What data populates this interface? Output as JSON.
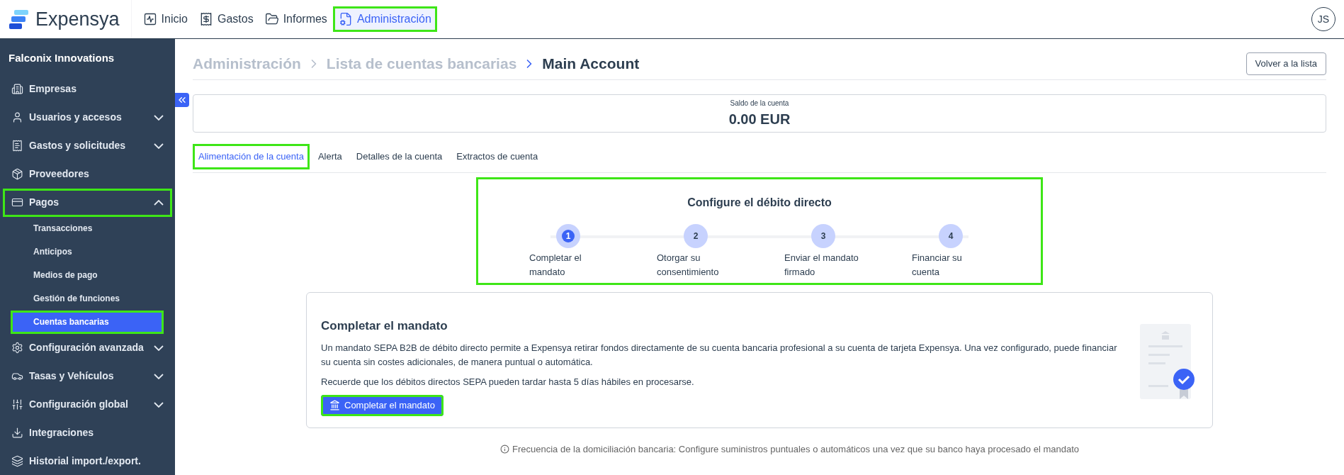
{
  "header": {
    "logo": "Expensya",
    "nav": [
      {
        "label": "Inicio",
        "selected": false,
        "highlighted": false
      },
      {
        "label": "Gastos",
        "selected": false,
        "highlighted": false
      },
      {
        "label": "Informes",
        "selected": false,
        "highlighted": false
      },
      {
        "label": "Administración",
        "selected": true,
        "highlighted": true
      }
    ],
    "avatar": "JS"
  },
  "sidebar": {
    "company": "Falconix Innovations",
    "items": [
      {
        "label": "Empresas"
      },
      {
        "label": "Usuarios y accesos",
        "expanded": false
      },
      {
        "label": "Gastos y solicitudes",
        "expanded": false
      },
      {
        "label": "Proveedores"
      },
      {
        "label": "Pagos",
        "expanded": true,
        "highlighted": true,
        "children": [
          {
            "label": "Transacciones",
            "selected": false,
            "highlighted": false
          },
          {
            "label": "Anticipos",
            "selected": false,
            "highlighted": false
          },
          {
            "label": "Medios de pago",
            "selected": false,
            "highlighted": false
          },
          {
            "label": "Gestión de funciones",
            "selected": false,
            "highlighted": false
          },
          {
            "label": "Cuentas bancarias",
            "selected": true,
            "highlighted": true
          }
        ]
      },
      {
        "label": "Configuración avanzada",
        "expanded": false
      },
      {
        "label": "Tasas y Vehículos",
        "expanded": false
      },
      {
        "label": "Configuración global",
        "expanded": false
      },
      {
        "label": "Integraciones"
      },
      {
        "label": "Historial import./export."
      }
    ]
  },
  "breadcrumb": [
    "Administración",
    "Lista de cuentas bancarias",
    "Main Account"
  ],
  "back_button": "Volver a la lista",
  "balance": {
    "label": "Saldo de la cuenta",
    "value": "0.00 EUR"
  },
  "tabs": [
    {
      "label": "Alimentación de la cuenta",
      "selected": true,
      "highlighted": true
    },
    {
      "label": "Alerta",
      "selected": false,
      "highlighted": false
    },
    {
      "label": "Detalles de la cuenta",
      "selected": false,
      "highlighted": false
    },
    {
      "label": "Extractos de cuenta",
      "selected": false,
      "highlighted": false
    }
  ],
  "stepper": {
    "title": "Configure el débito directo",
    "highlighted": true,
    "steps": [
      {
        "number": "1",
        "label": "Completar el mandato",
        "selected": true
      },
      {
        "number": "2",
        "label": "Otorgar su consentimiento",
        "selected": false
      },
      {
        "number": "3",
        "label": "Enviar el mandato firmado",
        "selected": false
      },
      {
        "number": "4",
        "label": "Financiar su cuenta",
        "selected": false
      }
    ]
  },
  "mandate": {
    "title": "Completar el mandato",
    "paragraphs": [
      "Un mandato SEPA B2B de débito directo permite a Expensya retirar fondos directamente de su cuenta bancaria profesional a su cuenta de tarjeta Expensya. Una vez configurado, puede financiar su cuenta sin costes adicionales, de manera puntual o automática.",
      "Recuerde que los débitos directos SEPA pueden tardar hasta 5 días hábiles en procesarse."
    ],
    "button": {
      "label": "Completar el mandato",
      "highlighted": true
    }
  },
  "note": "Frecuencia de la domiciliación bancaria: Configure suministros puntuales o automáticos una vez que su banco haya procesado el mandato"
}
